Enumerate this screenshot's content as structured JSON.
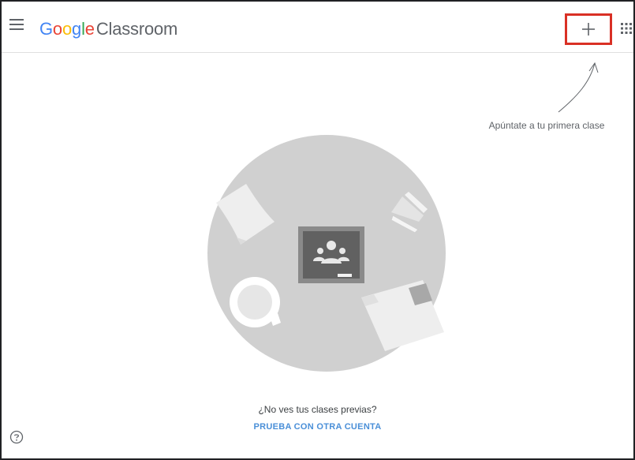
{
  "header": {
    "brand_google": "Google",
    "brand_product": "Classroom",
    "menu_icon": "hamburger-menu-icon",
    "add_icon": "plus-icon",
    "apps_icon": "apps-grid-icon"
  },
  "hint": {
    "text": "Apúntate a tu primera clase"
  },
  "empty_state": {
    "question": "¿No ves tus clases previas?",
    "action": "PRUEBA CON OTRA CUENTA"
  },
  "footer": {
    "help_icon": "help-icon"
  },
  "colors": {
    "google_blue": "#4285f4",
    "google_red": "#ea4335",
    "google_yellow": "#fbbc05",
    "google_green": "#34a853",
    "highlight": "#d93025",
    "link": "#4a8fd8"
  }
}
